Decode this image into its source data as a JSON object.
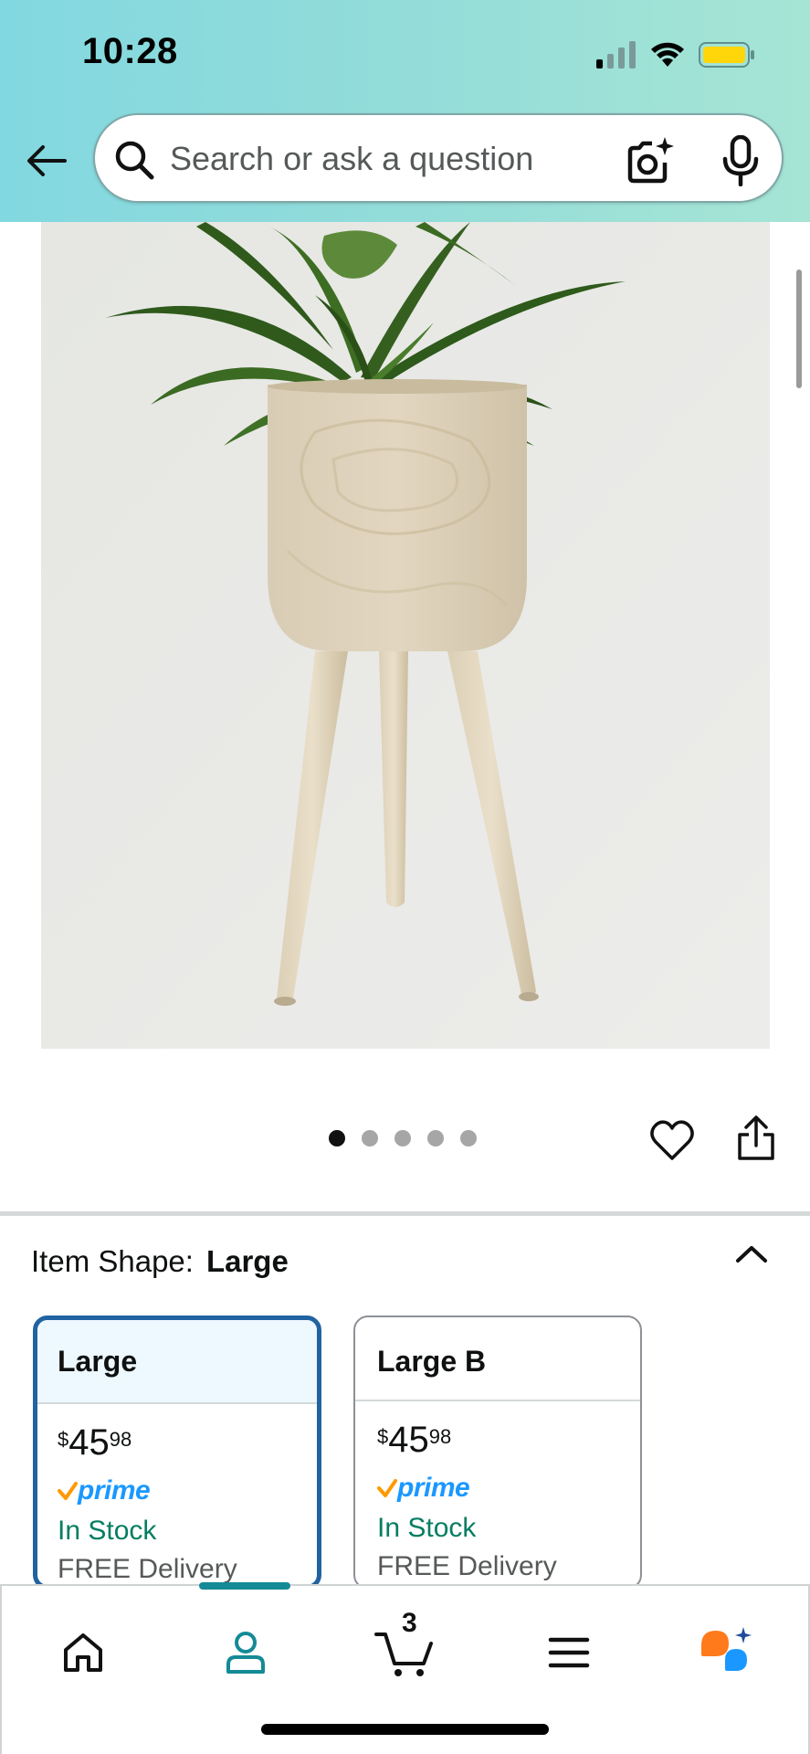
{
  "status_bar": {
    "time": "10:28"
  },
  "search": {
    "placeholder": "Search or ask a question"
  },
  "carousel": {
    "dot_count": 5,
    "active_index": 0
  },
  "item_shape": {
    "label": "Item Shape:",
    "selected": "Large",
    "options": [
      {
        "name": "Large",
        "price_symbol": "$",
        "price_whole": "45",
        "price_fraction": "98",
        "prime": "prime",
        "stock": "In Stock",
        "delivery": "FREE Delivery"
      },
      {
        "name": "Large B",
        "price_symbol": "$",
        "price_whole": "45",
        "price_fraction": "98",
        "prime": "prime",
        "stock": "In Stock",
        "delivery": "FREE Delivery"
      }
    ]
  },
  "bottom_nav": {
    "cart_count": "3",
    "active": "account"
  },
  "colors": {
    "header_gradient_start": "#82d8e0",
    "header_gradient_end": "#a6e5d5",
    "selected_border": "#2162a1",
    "stock_green": "#067d62",
    "prime_blue": "#1a98ff",
    "nav_active": "#148a96"
  }
}
